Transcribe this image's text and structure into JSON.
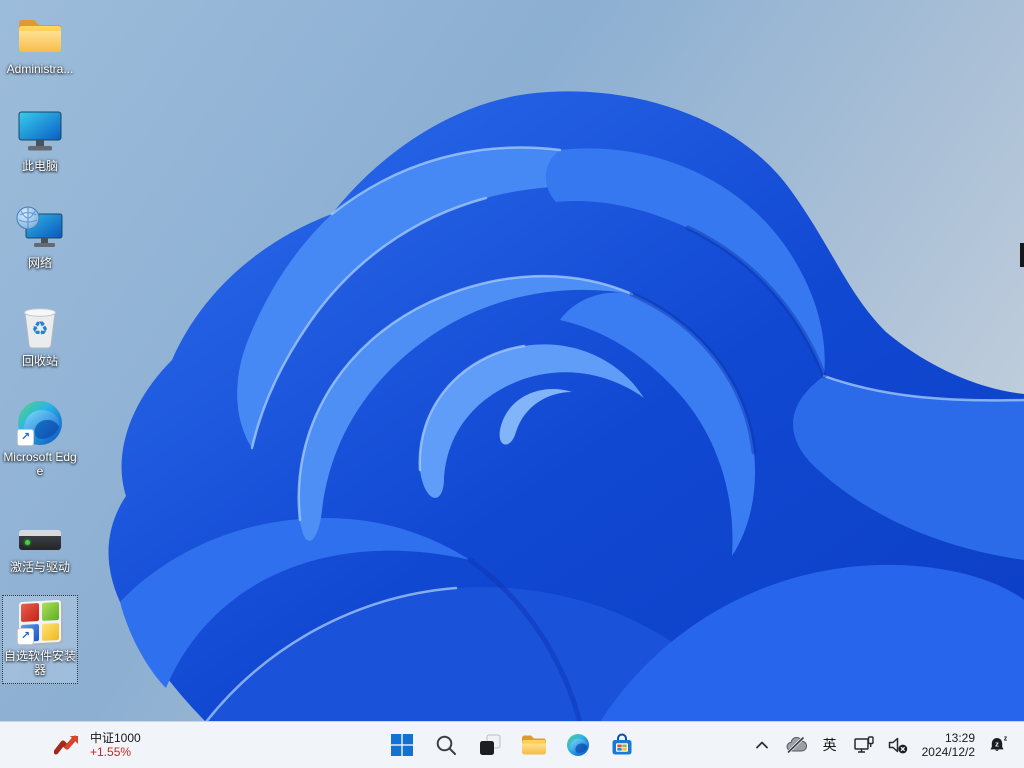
{
  "wallpaper": {
    "style": "windows-11-bloom",
    "background_top": "#9dbcdb",
    "background_bottom": "#cfd7e0",
    "bloom_blue": "#1c57e2"
  },
  "desktop": {
    "icons": [
      {
        "id": "administrator",
        "label": "Administra...",
        "icon": "folder-icon"
      },
      {
        "id": "this-pc",
        "label": "此电脑",
        "icon": "monitor-icon"
      },
      {
        "id": "network",
        "label": "网络",
        "icon": "network-globe-icon"
      },
      {
        "id": "recycle-bin",
        "label": "回收站",
        "icon": "recycle-bin-icon"
      },
      {
        "id": "microsoft-edge",
        "label": "Microsoft Edge",
        "icon": "edge-icon",
        "shortcut": true
      },
      {
        "id": "activation-drivers",
        "label": "激活与驱动",
        "icon": "external-drive-icon"
      },
      {
        "id": "software-installer",
        "label": "自选软件安装器",
        "icon": "four-color-window-icon",
        "shortcut": true,
        "selected": true
      }
    ],
    "glyphs": {
      "recycle": "♻",
      "shortcut_arrow": "↗"
    }
  },
  "taskbar": {
    "stock_widget": {
      "title": "中证1000",
      "change": "+1.55%",
      "change_color": "#c42b1c",
      "icon": "stock-trend-icon"
    },
    "center_buttons": [
      {
        "name": "start"
      },
      {
        "name": "search"
      },
      {
        "name": "task-view"
      },
      {
        "name": "file-explorer"
      },
      {
        "name": "edge"
      },
      {
        "name": "microsoft-store"
      }
    ],
    "tray": {
      "hidden_icons": "chevron-up-icon",
      "onedrive": "cloud-off-icon",
      "ime_label": "英",
      "network": "ethernet-monitor-icon",
      "volume": "volume-mute-icon",
      "clock": {
        "time": "13:29",
        "date": "2024/12/2"
      },
      "notifications": "bell-dnd-icon"
    }
  }
}
